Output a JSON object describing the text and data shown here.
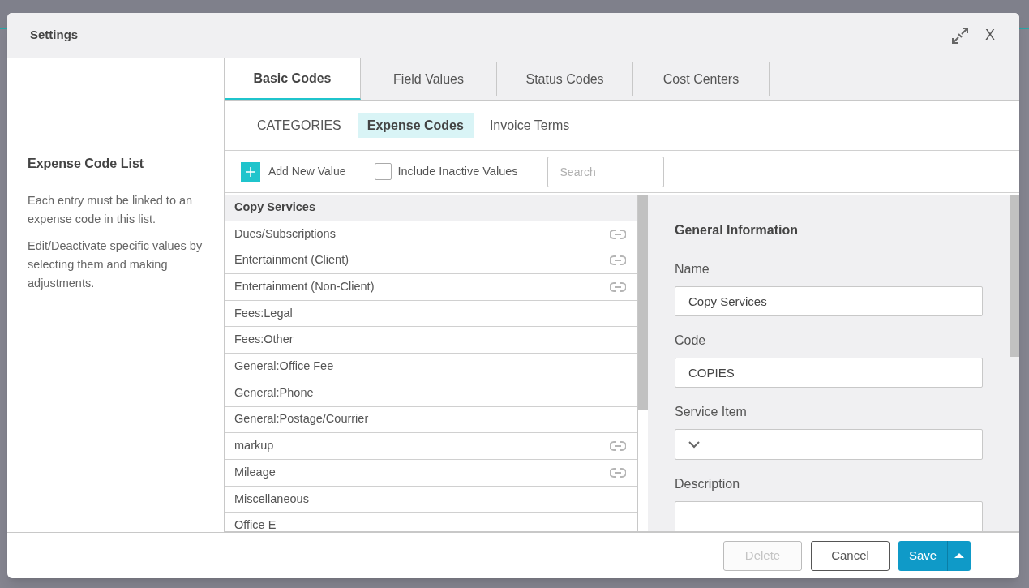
{
  "dialog": {
    "title": "Settings",
    "close_label": "X"
  },
  "sidebar": {
    "heading": "Expense Code List",
    "paragraphs": [
      "Each entry must be linked to an expense code in this list.",
      "Edit/Deactivate specific values by selecting them and making adjustments."
    ]
  },
  "tabs": [
    {
      "label": "Basic Codes",
      "selected": true
    },
    {
      "label": "Field Values",
      "selected": false
    },
    {
      "label": "Status Codes",
      "selected": false
    },
    {
      "label": "Cost Centers",
      "selected": false
    }
  ],
  "subtabs": [
    {
      "label": "CATEGORIES",
      "selected": false
    },
    {
      "label": "Expense Codes",
      "selected": true
    },
    {
      "label": "Invoice Terms",
      "selected": false
    }
  ],
  "toolbar": {
    "add_label": "Add New Value",
    "include_inactive": {
      "label": "Include Inactive Values",
      "checked": false
    },
    "search": {
      "placeholder": "Search"
    }
  },
  "list": [
    {
      "label": "Copy Services",
      "selected": true,
      "linked": false
    },
    {
      "label": "Dues/Subscriptions",
      "selected": false,
      "linked": true
    },
    {
      "label": "Entertainment (Client)",
      "selected": false,
      "linked": true
    },
    {
      "label": "Entertainment (Non-Client)",
      "selected": false,
      "linked": true
    },
    {
      "label": "Fees:Legal",
      "selected": false,
      "linked": false
    },
    {
      "label": "Fees:Other",
      "selected": false,
      "linked": false
    },
    {
      "label": "General:Office Fee",
      "selected": false,
      "linked": false
    },
    {
      "label": "General:Phone",
      "selected": false,
      "linked": false
    },
    {
      "label": "General:Postage/Courrier",
      "selected": false,
      "linked": false
    },
    {
      "label": "markup",
      "selected": false,
      "linked": true
    },
    {
      "label": "Mileage",
      "selected": false,
      "linked": true
    },
    {
      "label": "Miscellaneous",
      "selected": false,
      "linked": false
    },
    {
      "label": "Office E",
      "selected": false,
      "linked": false
    }
  ],
  "details": {
    "heading": "General Information",
    "fields": [
      {
        "label": "Name",
        "kind": "text",
        "value": "Copy Services"
      },
      {
        "label": "Code",
        "kind": "text",
        "value": "COPIES"
      },
      {
        "label": "Service Item",
        "kind": "select"
      },
      {
        "label": "Description",
        "kind": "textarea"
      }
    ]
  },
  "footer": [
    {
      "label": "Delete",
      "kind": "secondary",
      "disabled": true
    },
    {
      "label": "Cancel",
      "kind": "secondary",
      "disabled": false
    },
    {
      "label": "Save",
      "kind": "primary"
    }
  ]
}
